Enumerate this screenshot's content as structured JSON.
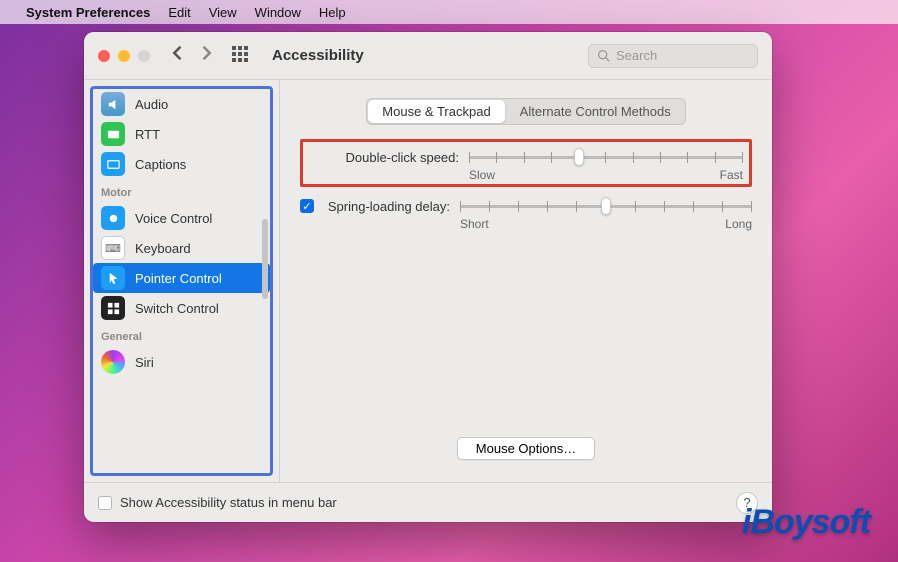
{
  "menubar": {
    "app": "System Preferences",
    "items": [
      "Edit",
      "View",
      "Window",
      "Help"
    ]
  },
  "window": {
    "title": "Accessibility",
    "search_placeholder": "Search"
  },
  "sidebar": {
    "sections": [
      {
        "header": null,
        "items": [
          {
            "icon": "audio",
            "label": "Audio"
          },
          {
            "icon": "rtt",
            "label": "RTT"
          },
          {
            "icon": "captions",
            "label": "Captions"
          }
        ]
      },
      {
        "header": "Motor",
        "items": [
          {
            "icon": "voice-control",
            "label": "Voice Control"
          },
          {
            "icon": "keyboard",
            "label": "Keyboard"
          },
          {
            "icon": "pointer",
            "label": "Pointer Control",
            "selected": true
          },
          {
            "icon": "switch",
            "label": "Switch Control"
          }
        ]
      },
      {
        "header": "General",
        "items": [
          {
            "icon": "siri",
            "label": "Siri"
          }
        ]
      }
    ]
  },
  "content": {
    "tabs": [
      "Mouse & Trackpad",
      "Alternate Control Methods"
    ],
    "selected_tab": "Mouse & Trackpad",
    "double_click": {
      "label": "Double-click speed:",
      "min_label": "Slow",
      "max_label": "Fast",
      "ticks": 11,
      "value_index": 4
    },
    "spring_loading": {
      "label": "Spring-loading delay:",
      "checked": true,
      "min_label": "Short",
      "max_label": "Long",
      "ticks": 11,
      "value_index": 5
    },
    "mouse_options_label": "Mouse Options…"
  },
  "footer": {
    "checkbox_label": "Show Accessibility status in menu bar",
    "checked": false
  },
  "watermark": "iBoysoft"
}
